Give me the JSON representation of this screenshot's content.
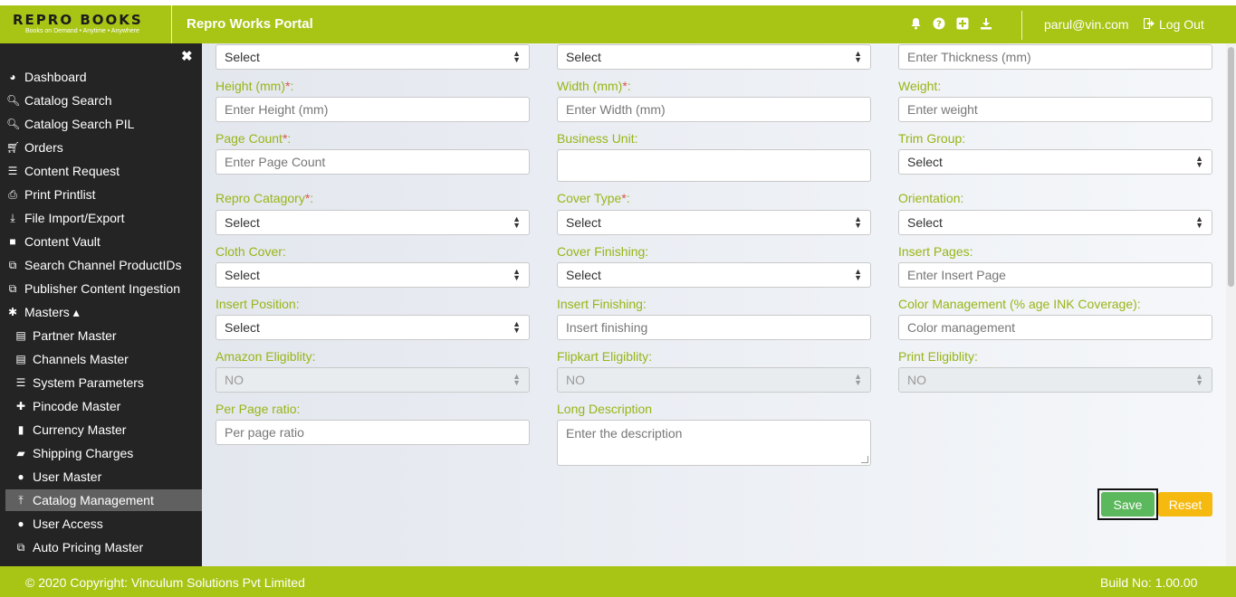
{
  "header": {
    "logo_text": "REPRO BOOKS",
    "logo_tagline": "Books on Demand • Anytime • Anywhere",
    "portal_title": "Repro Works Portal",
    "user_email": "parul@vin.com",
    "logout_label": "Log Out",
    "icons": [
      "bell-icon",
      "question-icon",
      "plus-square-icon",
      "download-icon"
    ]
  },
  "sidebar": {
    "items": [
      {
        "label": "Dashboard",
        "icon": "dashboard-icon"
      },
      {
        "label": "Catalog Search",
        "icon": "search-icon"
      },
      {
        "label": "Catalog Search PIL",
        "icon": "search-icon"
      },
      {
        "label": "Orders",
        "icon": "cart-icon"
      },
      {
        "label": "Content Request",
        "icon": "list-icon"
      },
      {
        "label": "Print Printlist",
        "icon": "print-icon"
      },
      {
        "label": "File Import/Export",
        "icon": "download-icon"
      },
      {
        "label": "Content Vault",
        "icon": "folder-icon"
      },
      {
        "label": "Search Channel ProductIDs",
        "icon": "copy-icon"
      },
      {
        "label": "Publisher Content Ingestion",
        "icon": "copy-icon"
      },
      {
        "label": "Masters ▴",
        "icon": "asterisk-icon"
      },
      {
        "label": "Partner Master",
        "icon": "id-card-icon"
      },
      {
        "label": "Channels Master",
        "icon": "id-card-icon"
      },
      {
        "label": "System Parameters",
        "icon": "list-ol-icon"
      },
      {
        "label": "Pincode Master",
        "icon": "pin-icon"
      },
      {
        "label": "Currency Master",
        "icon": "barcode-icon"
      },
      {
        "label": "Shipping Charges",
        "icon": "truck-icon"
      },
      {
        "label": "User Master",
        "icon": "user-icon"
      },
      {
        "label": "Catalog Management",
        "icon": "upload-icon"
      },
      {
        "label": "User Access",
        "icon": "user-icon"
      },
      {
        "label": "Auto Pricing Master",
        "icon": "copy-icon"
      }
    ]
  },
  "form": {
    "row0": {
      "c1": "Select",
      "c2": "Select",
      "c3": "Enter Thickness (mm)"
    },
    "height_label": "Height (mm)",
    "height_ph": "Enter Height (mm)",
    "width_label": "Width (mm)",
    "width_ph": "Enter Width (mm)",
    "weight_label": "Weight:",
    "weight_ph": "Enter weight",
    "page_count_label": "Page Count",
    "page_count_ph": "Enter Page Count",
    "business_unit_label": "Business Unit:",
    "business_unit_value": "",
    "trim_group_label": "Trim Group:",
    "trim_group_value": "Select",
    "repro_category_label": "Repro Catagory",
    "repro_category_value": "Select",
    "cover_type_label": "Cover Type",
    "cover_type_value": "Select",
    "orientation_label": "Orientation:",
    "orientation_value": "Select",
    "cloth_cover_label": "Cloth Cover:",
    "cloth_cover_value": "Select",
    "cover_finishing_label": "Cover Finishing:",
    "cover_finishing_value": "Select",
    "insert_pages_label": "Insert Pages:",
    "insert_pages_ph": "Enter Insert Page",
    "insert_position_label": "Insert Position:",
    "insert_position_value": "Select",
    "insert_finishing_label": "Insert Finishing:",
    "insert_finishing_ph": "Insert finishing",
    "color_mgmt_label": "Color Management (% age INK Coverage):",
    "color_mgmt_ph": "Color management",
    "amazon_label": "Amazon Eligiblity:",
    "amazon_value": "NO",
    "flipkart_label": "Flipkart Eligiblity:",
    "flipkart_value": "NO",
    "print_label": "Print Eligiblity:",
    "print_value": "NO",
    "per_page_label": "Per Page ratio:",
    "per_page_ph": "Per page ratio",
    "long_desc_label": "Long Description",
    "long_desc_ph": "Enter the description",
    "required_mark": "*",
    "colon": ":",
    "save_label": "Save",
    "reset_label": "Reset"
  },
  "footer": {
    "copyright": "© 2020 Copyright: Vinculum Solutions Pvt Limited",
    "build": "Build No: 1.00.00"
  },
  "colors": {
    "brand": "#a8c414",
    "sidebar": "#242424",
    "label": "#98b516",
    "save": "#5cb85c",
    "reset": "#f5b90f"
  }
}
